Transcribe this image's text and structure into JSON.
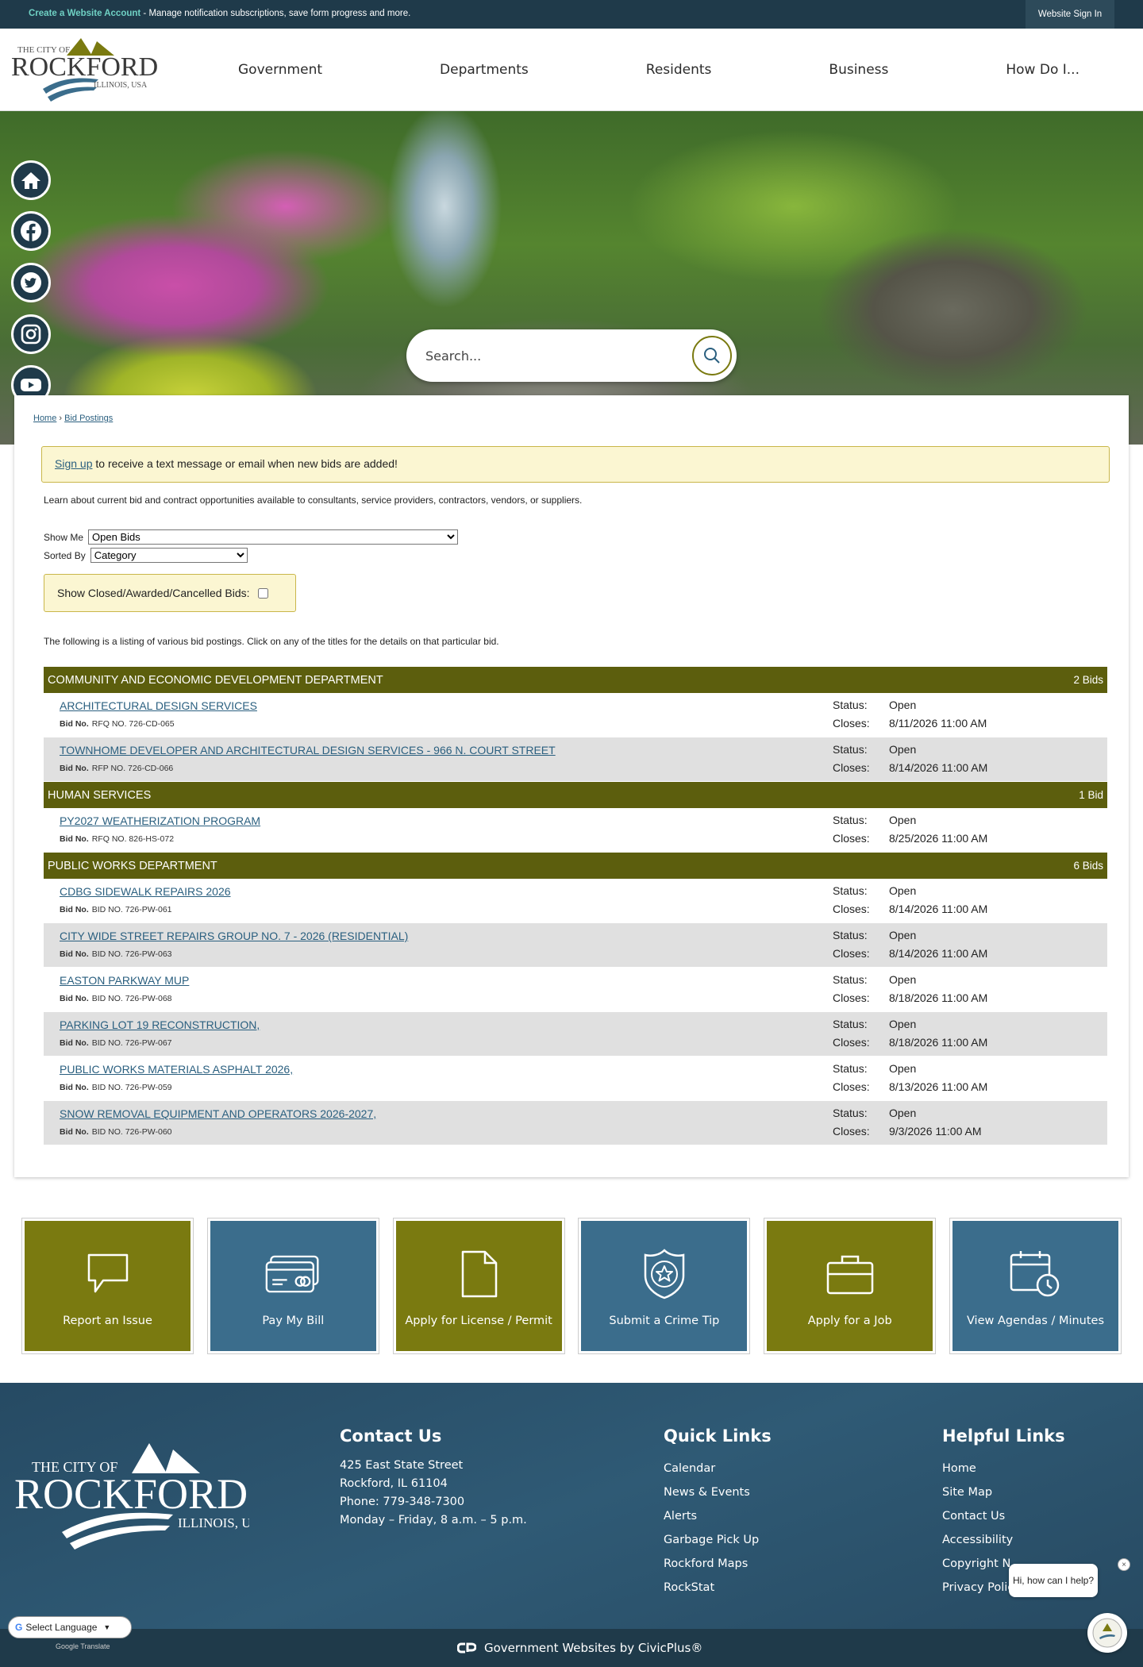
{
  "topbar": {
    "account_link": "Create a Website Account",
    "account_text": " - Manage notification subscriptions, save form progress and more.",
    "sign_in": "Website Sign In"
  },
  "logo": {
    "line1": "THE CITY OF",
    "line2": "ROCKFORD",
    "line3": "ILLINOIS, USA"
  },
  "nav": [
    "Government",
    "Departments",
    "Residents",
    "Business",
    "How Do I..."
  ],
  "social": [
    "home-icon",
    "facebook-icon",
    "twitter-icon",
    "instagram-icon",
    "youtube-icon"
  ],
  "search": {
    "placeholder": "Search..."
  },
  "breadcrumb": {
    "home": "Home",
    "current": "Bid Postings"
  },
  "alert": {
    "link": "Sign up",
    "text": " to receive a text message or email when new bids are added!"
  },
  "intro": "Learn about current bid and contract opportunities available to consultants, service providers, contractors, vendors, or suppliers.",
  "filters": {
    "show_me_label": "Show Me",
    "show_me_value": "Open Bids",
    "sorted_by_label": "Sorted By",
    "sorted_by_value": "Category",
    "closed_label": "Show Closed/Awarded/Cancelled Bids:"
  },
  "listing_note": "The following is a listing of various bid postings. Click on any of the titles for the details on that particular bid.",
  "labels": {
    "bid_no": "Bid No.",
    "status": "Status:",
    "closes": "Closes:"
  },
  "categories": [
    {
      "name": "Community and Economic Development Department",
      "count": "2 Bids",
      "bids": [
        {
          "title": "ARCHITECTURAL DESIGN SERVICES",
          "number": "RFQ NO. 726-CD-065",
          "status": "Open",
          "closes": "8/11/2026 11:00 AM"
        },
        {
          "title": "TOWNHOME DEVELOPER AND ARCHITECTURAL DESIGN SERVICES - 966 N. COURT STREET",
          "number": "RFP NO. 726-CD-066",
          "status": "Open",
          "closes": "8/14/2026 11:00 AM"
        }
      ]
    },
    {
      "name": "Human Services",
      "count": "1 Bid",
      "bids": [
        {
          "title": "PY2027 WEATHERIZATION PROGRAM",
          "number": "RFQ NO. 826-HS-072",
          "status": "Open",
          "closes": "8/25/2026 11:00 AM"
        }
      ]
    },
    {
      "name": "Public Works Department",
      "count": "6 Bids",
      "bids": [
        {
          "title": "CDBG SIDEWALK REPAIRS 2026",
          "number": "BID NO. 726-PW-061",
          "status": "Open",
          "closes": "8/14/2026 11:00 AM"
        },
        {
          "title": "CITY WIDE STREET REPAIRS GROUP NO. 7 - 2026 (RESIDENTIAL)",
          "number": "BID NO. 726-PW-063",
          "status": "Open",
          "closes": "8/14/2026 11:00 AM"
        },
        {
          "title": "EASTON PARKWAY MUP",
          "number": "BID NO. 726-PW-068",
          "status": "Open",
          "closes": "8/18/2026 11:00 AM"
        },
        {
          "title": "PARKING LOT 19 RECONSTRUCTION,",
          "number": "BID NO. 726-PW-067",
          "status": "Open",
          "closes": "8/18/2026 11:00 AM"
        },
        {
          "title": "PUBLIC WORKS MATERIALS ASPHALT 2026,",
          "number": "BID NO. 726-PW-059",
          "status": "Open",
          "closes": "8/13/2026 11:00 AM"
        },
        {
          "title": "SNOW REMOVAL EQUIPMENT AND OPERATORS 2026-2027,",
          "number": "BID NO. 726-PW-060",
          "status": "Open",
          "closes": "9/3/2026 11:00 AM"
        }
      ]
    }
  ],
  "tiles": [
    {
      "label": "Report an Issue",
      "icon": "speech-bubble-icon",
      "color": "olive"
    },
    {
      "label": "Pay My Bill",
      "icon": "credit-card-icon",
      "color": "blue"
    },
    {
      "label": "Apply for License / Permit",
      "icon": "document-icon",
      "color": "olive"
    },
    {
      "label": "Submit a Crime Tip",
      "icon": "police-badge-icon",
      "color": "blue"
    },
    {
      "label": "Apply for a Job",
      "icon": "briefcase-icon",
      "color": "olive"
    },
    {
      "label": "View Agendas / Minutes",
      "icon": "calendar-clock-icon",
      "color": "blue"
    }
  ],
  "footer": {
    "contact": {
      "heading": "Contact Us",
      "address1": "425 East State Street",
      "address2": "Rockford, IL 61104",
      "phone": "Phone: 779-348-7300",
      "hours": "Monday – Friday, 8 a.m. – 5 p.m."
    },
    "quick_links": {
      "heading": "Quick Links",
      "items": [
        "Calendar",
        "News & Events",
        "Alerts",
        "Garbage Pick Up",
        "Rockford Maps",
        "RockStat"
      ]
    },
    "helpful_links": {
      "heading": "Helpful Links",
      "items": [
        "Home",
        "Site Map",
        "Contact Us",
        "Accessibility",
        "Copyright N",
        "Privacy Polic"
      ]
    },
    "powered_by": "Government Websites by CivicPlus®"
  },
  "translate": {
    "label": "Select Language",
    "powered": "Google Translate"
  },
  "chat": {
    "prompt": "Hi, how can I help?",
    "close": "×"
  },
  "colors": {
    "olive": "#5c5e0d",
    "tile_olive": "#7a7a10",
    "tile_blue": "#3b6d8c",
    "navy": "#1f3a4a",
    "link": "#2a5f7f"
  }
}
